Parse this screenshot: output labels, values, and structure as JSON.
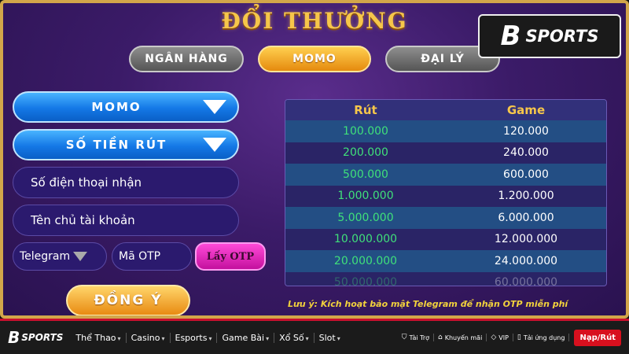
{
  "title": "ĐỔI THƯỞNG",
  "tabs": [
    {
      "label": "NGÂN HÀNG",
      "active": false
    },
    {
      "label": "MOMO",
      "active": true
    },
    {
      "label": "ĐẠI LÝ",
      "active": false
    }
  ],
  "form": {
    "method_select": "MOMO",
    "amount_select": "SỐ TIỀN RÚT",
    "phone_placeholder": "Số điện thoại nhận",
    "name_placeholder": "Tên chủ tài khoản",
    "otp_channel": "Telegram",
    "otp_placeholder": "Mã OTP",
    "get_otp_label": "Lấy OTP",
    "submit_label": "ĐỒNG Ý"
  },
  "table": {
    "headers": [
      "Rút",
      "Game"
    ],
    "rows": [
      [
        "100.000",
        "120.000"
      ],
      [
        "200.000",
        "240.000"
      ],
      [
        "500.000",
        "600.000"
      ],
      [
        "1.000.000",
        "1.200.000"
      ],
      [
        "5.000.000",
        "6.000.000"
      ],
      [
        "10.000.000",
        "12.000.000"
      ],
      [
        "20.000.000",
        "24.000.000"
      ],
      [
        "50.000.000",
        "60.000.000"
      ]
    ]
  },
  "note": "Lưu ý: Kích hoạt bảo mật Telegram để nhận OTP miễn phí",
  "brand": {
    "mark": "B",
    "name": "SPORTS"
  },
  "navbar": {
    "items": [
      {
        "label": "Thể Thao"
      },
      {
        "label": "Casino"
      },
      {
        "label": "Esports"
      },
      {
        "label": "Game Bài"
      },
      {
        "label": "Xổ Số"
      },
      {
        "label": "Slot"
      }
    ],
    "right": [
      {
        "label": "Tài Trợ",
        "icon": "sponsor-icon"
      },
      {
        "label": "Khuyến mãi",
        "icon": "gift-icon"
      },
      {
        "label": "VIP",
        "icon": "diamond-icon"
      },
      {
        "label": "Tải ứng dụng",
        "icon": "phone-icon"
      }
    ],
    "deposit_label": "Nạp/Rút"
  },
  "colors": {
    "gold": "#f6c64a",
    "green": "#3fe07a",
    "blue": "#1478e6",
    "pink": "#ff4ad8",
    "red": "#d8101e"
  }
}
